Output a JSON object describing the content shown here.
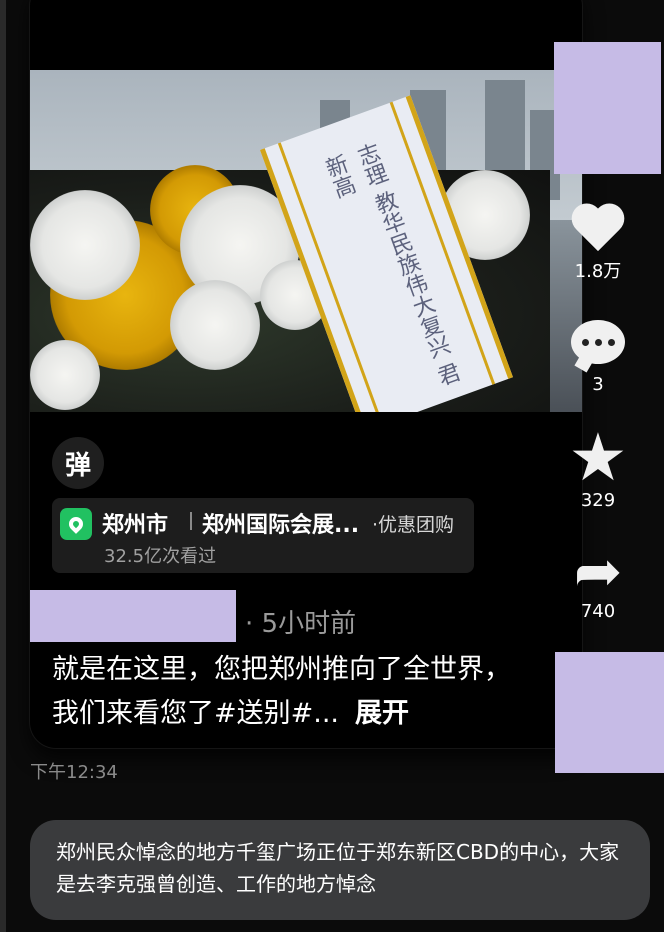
{
  "post": {
    "ribbon_text": "志理 教华民族伟大复兴 君新高",
    "danmaku_label": "弹",
    "location": {
      "city": "郑州市",
      "place": "郑州国际会展...",
      "deal": "·优惠团购",
      "views": "32.5亿次看过"
    },
    "time_ago": "· 5小时前",
    "caption": "就是在这里，您把郑州推向了全世界，我们来看您了#送别#...",
    "expand_label": "展开"
  },
  "actions": {
    "likes": "1.8万",
    "comments": "3",
    "favorites": "329",
    "shares": "740"
  },
  "chat": {
    "timestamp": "下午12:34",
    "reply": "郑州民众悼念的地方千玺广场正位于郑东新区CBD的中心，大家是去李克强曾创造、工作的地方悼念"
  },
  "colors": {
    "background": "#000000",
    "redaction": "#c6bbe6",
    "pin_green": "#21c161",
    "bubble_gray": "#3a3b3d"
  }
}
